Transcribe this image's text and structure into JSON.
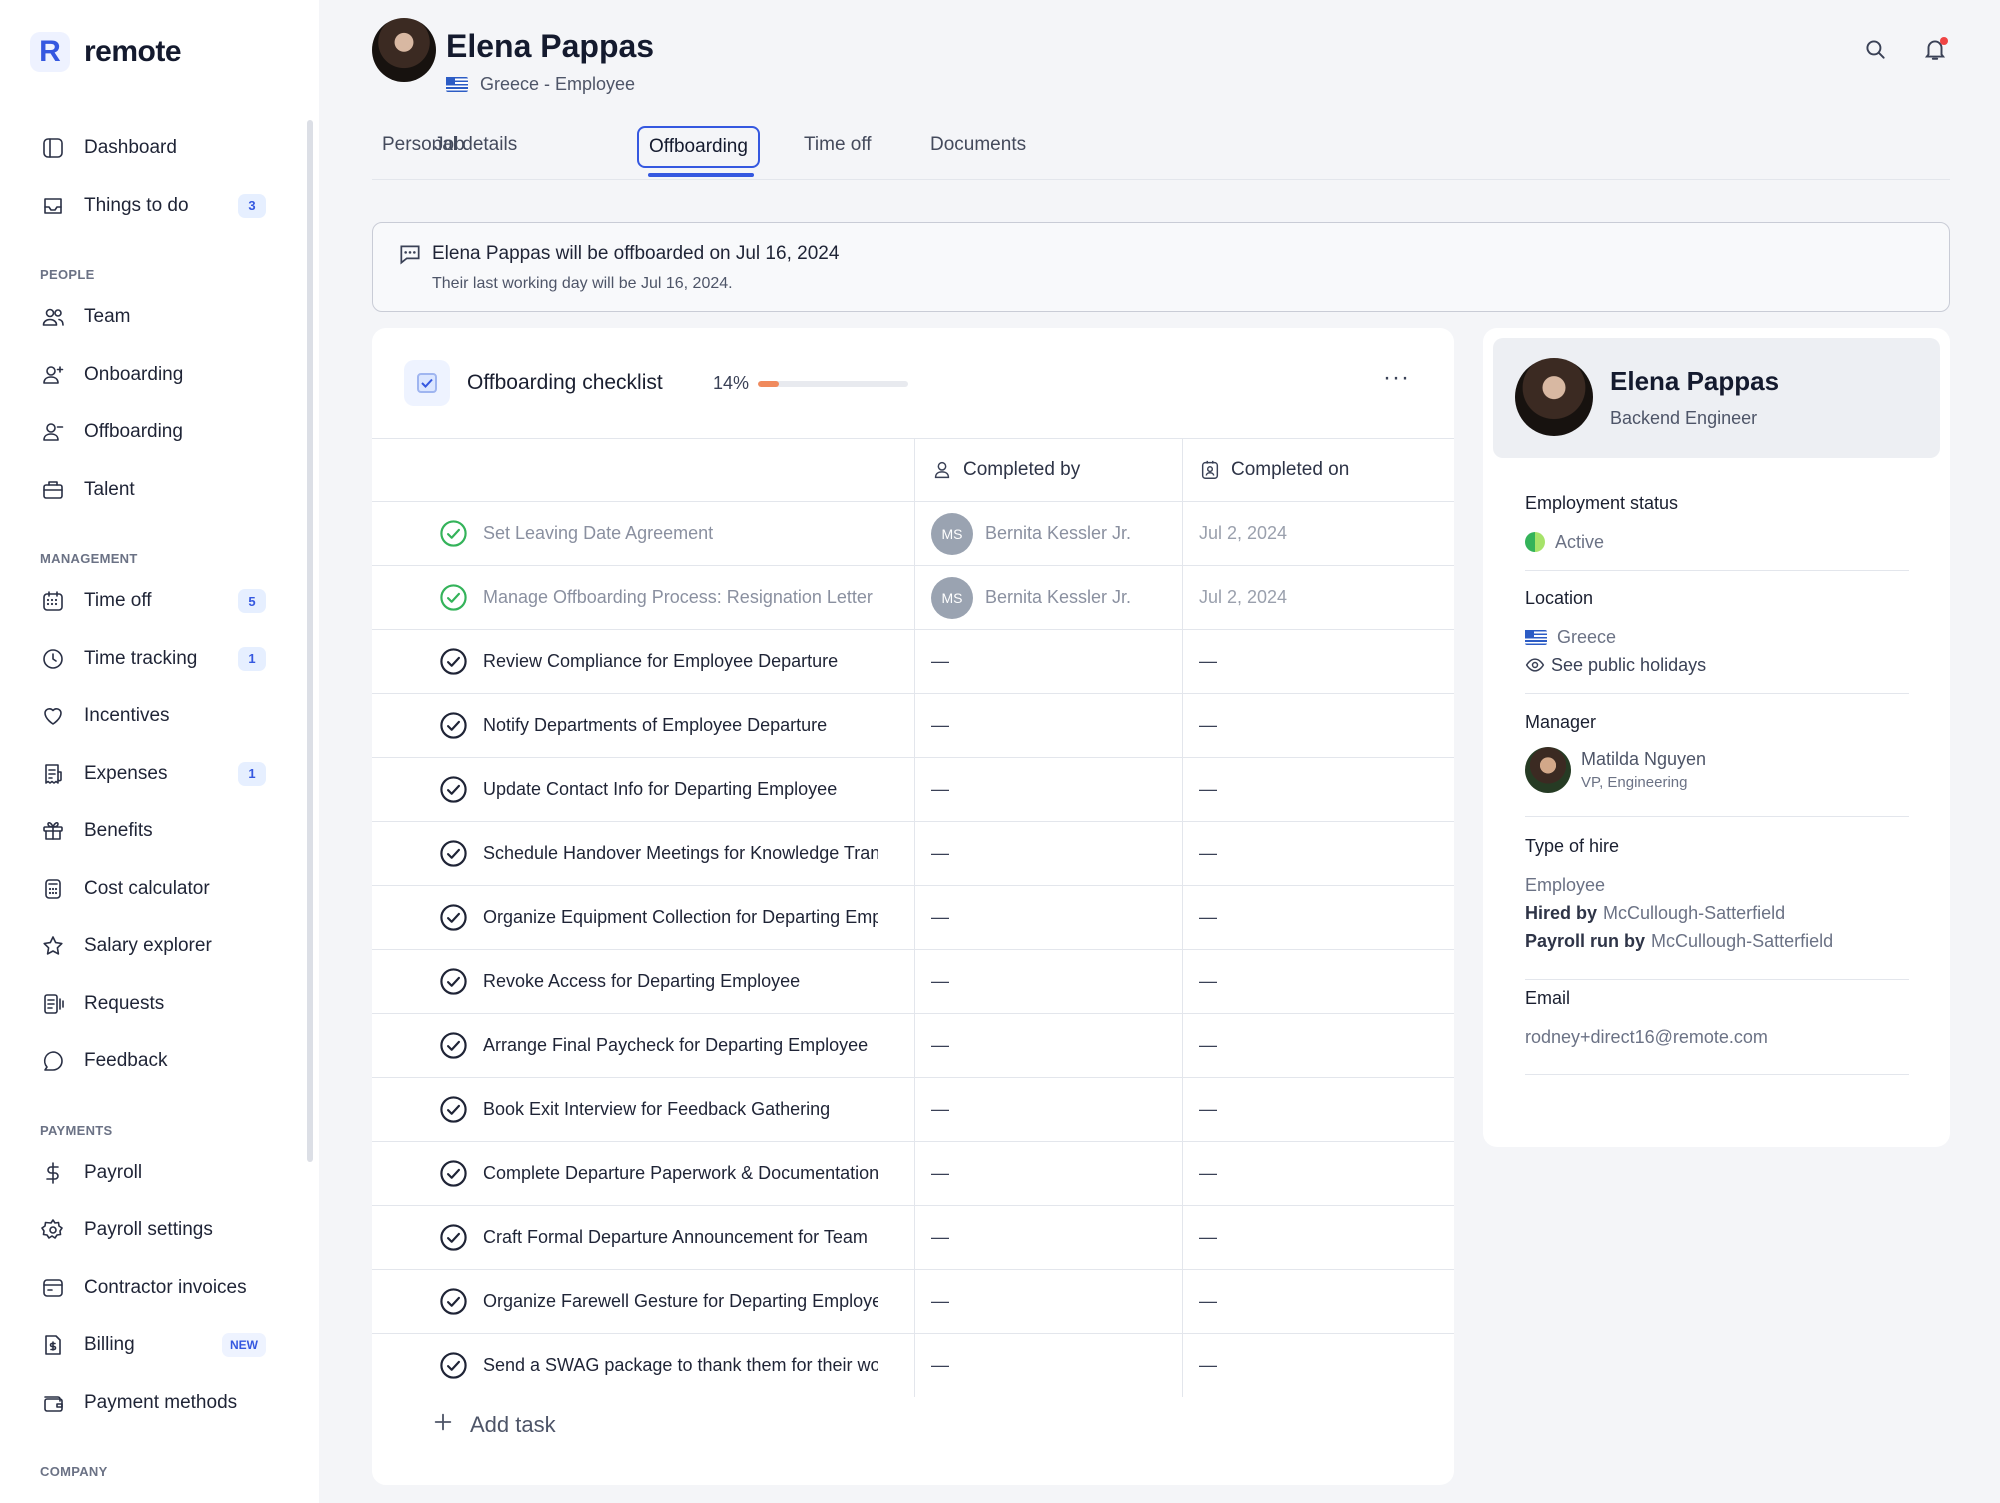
{
  "app": {
    "logo_letter": "R",
    "name": "remote"
  },
  "sidebar": {
    "top": [
      {
        "label": "Dashboard",
        "icon": "dashboard-icon"
      },
      {
        "label": "Things to do",
        "icon": "inbox-icon",
        "badge": "3"
      }
    ],
    "sections": [
      {
        "title": "PEOPLE",
        "items": [
          {
            "label": "Team",
            "icon": "team-icon"
          },
          {
            "label": "Onboarding",
            "icon": "user-plus-icon"
          },
          {
            "label": "Offboarding",
            "icon": "user-minus-icon"
          },
          {
            "label": "Talent",
            "icon": "briefcase-icon"
          }
        ]
      },
      {
        "title": "MANAGEMENT",
        "items": [
          {
            "label": "Time off",
            "icon": "calendar-icon",
            "badge": "5"
          },
          {
            "label": "Time tracking",
            "icon": "clock-icon",
            "badge": "1"
          },
          {
            "label": "Incentives",
            "icon": "heart-icon"
          },
          {
            "label": "Expenses",
            "icon": "receipt-icon",
            "badge": "1"
          },
          {
            "label": "Benefits",
            "icon": "gift-icon"
          },
          {
            "label": "Cost calculator",
            "icon": "calculator-icon"
          },
          {
            "label": "Salary explorer",
            "icon": "star-icon"
          },
          {
            "label": "Requests",
            "icon": "request-icon"
          },
          {
            "label": "Feedback",
            "icon": "chat-icon"
          }
        ]
      },
      {
        "title": "PAYMENTS",
        "items": [
          {
            "label": "Payroll",
            "icon": "dollar-icon"
          },
          {
            "label": "Payroll settings",
            "icon": "gear-icon"
          },
          {
            "label": "Contractor invoices",
            "icon": "invoice-icon"
          },
          {
            "label": "Billing",
            "icon": "billing-icon",
            "badge": "NEW"
          },
          {
            "label": "Payment methods",
            "icon": "wallet-icon"
          }
        ]
      },
      {
        "title": "COMPANY",
        "items": []
      }
    ]
  },
  "header": {
    "name": "Elena Pappas",
    "subtitle": "Greece - Employee"
  },
  "tabs": [
    {
      "label": "Personal details"
    },
    {
      "label": "Job"
    },
    {
      "label": "Offboarding",
      "active": true
    },
    {
      "label": "Time off"
    },
    {
      "label": "Documents"
    }
  ],
  "notice": {
    "title": "Elena Pappas will be offboarded on Jul 16, 2024",
    "subtitle": "Their last working day will be Jul 16, 2024."
  },
  "checklist": {
    "title": "Offboarding checklist",
    "progress_percent": 14,
    "progress_label": "14%",
    "more": "···",
    "columns": {
      "completed_by": "Completed by",
      "completed_on": "Completed on"
    },
    "tasks": [
      {
        "name": "Set Leaving Date Agreement",
        "done": true,
        "by_initials": "MS",
        "by": "Bernita Kessler Jr.",
        "on": "Jul 2, 2024"
      },
      {
        "name": "Manage Offboarding Process: Resignation Letter",
        "done": true,
        "by_initials": "MS",
        "by": "Bernita Kessler Jr.",
        "on": "Jul 2, 2024"
      },
      {
        "name": "Review Compliance for Employee Departure",
        "done": false,
        "by": "—",
        "on": "—"
      },
      {
        "name": "Notify Departments of Employee Departure",
        "done": false,
        "by": "—",
        "on": "—"
      },
      {
        "name": "Update Contact Info for Departing Employee",
        "done": false,
        "by": "—",
        "on": "—"
      },
      {
        "name": "Schedule Handover Meetings for Knowledge Transfer",
        "done": false,
        "by": "—",
        "on": "—"
      },
      {
        "name": "Organize Equipment Collection for Departing Employee",
        "done": false,
        "by": "—",
        "on": "—"
      },
      {
        "name": "Revoke Access for Departing Employee",
        "done": false,
        "by": "—",
        "on": "—"
      },
      {
        "name": "Arrange Final Paycheck for Departing Employee",
        "done": false,
        "by": "—",
        "on": "—"
      },
      {
        "name": "Book Exit Interview for Feedback Gathering",
        "done": false,
        "by": "—",
        "on": "—"
      },
      {
        "name": "Complete Departure Paperwork & Documentation",
        "done": false,
        "by": "—",
        "on": "—"
      },
      {
        "name": "Craft Formal Departure Announcement for Team",
        "done": false,
        "by": "—",
        "on": "—"
      },
      {
        "name": "Organize Farewell Gesture for Departing Employee",
        "done": false,
        "by": "—",
        "on": "—"
      },
      {
        "name": "Send a SWAG package to thank them for their work",
        "done": false,
        "by": "—",
        "on": "—"
      }
    ],
    "add_task": "Add task"
  },
  "profile": {
    "name": "Elena Pappas",
    "role": "Backend Engineer",
    "employment_status": {
      "title": "Employment status",
      "value": "Active"
    },
    "location": {
      "title": "Location",
      "value": "Greece",
      "link": "See public holidays"
    },
    "manager": {
      "title": "Manager",
      "name": "Matilda Nguyen",
      "role": "VP, Engineering"
    },
    "type_of_hire": {
      "title": "Type of hire",
      "value": "Employee",
      "hired_by_label": "Hired by",
      "hired_by": "McCullough-Satterfield",
      "payroll_by_label": "Payroll run by",
      "payroll_by": "McCullough-Satterfield"
    },
    "email": {
      "title": "Email",
      "value": "rodney+direct16@remote.com"
    }
  },
  "colors": {
    "accent": "#3558e0",
    "progress": "#f08a5d",
    "success": "#34b35a"
  }
}
